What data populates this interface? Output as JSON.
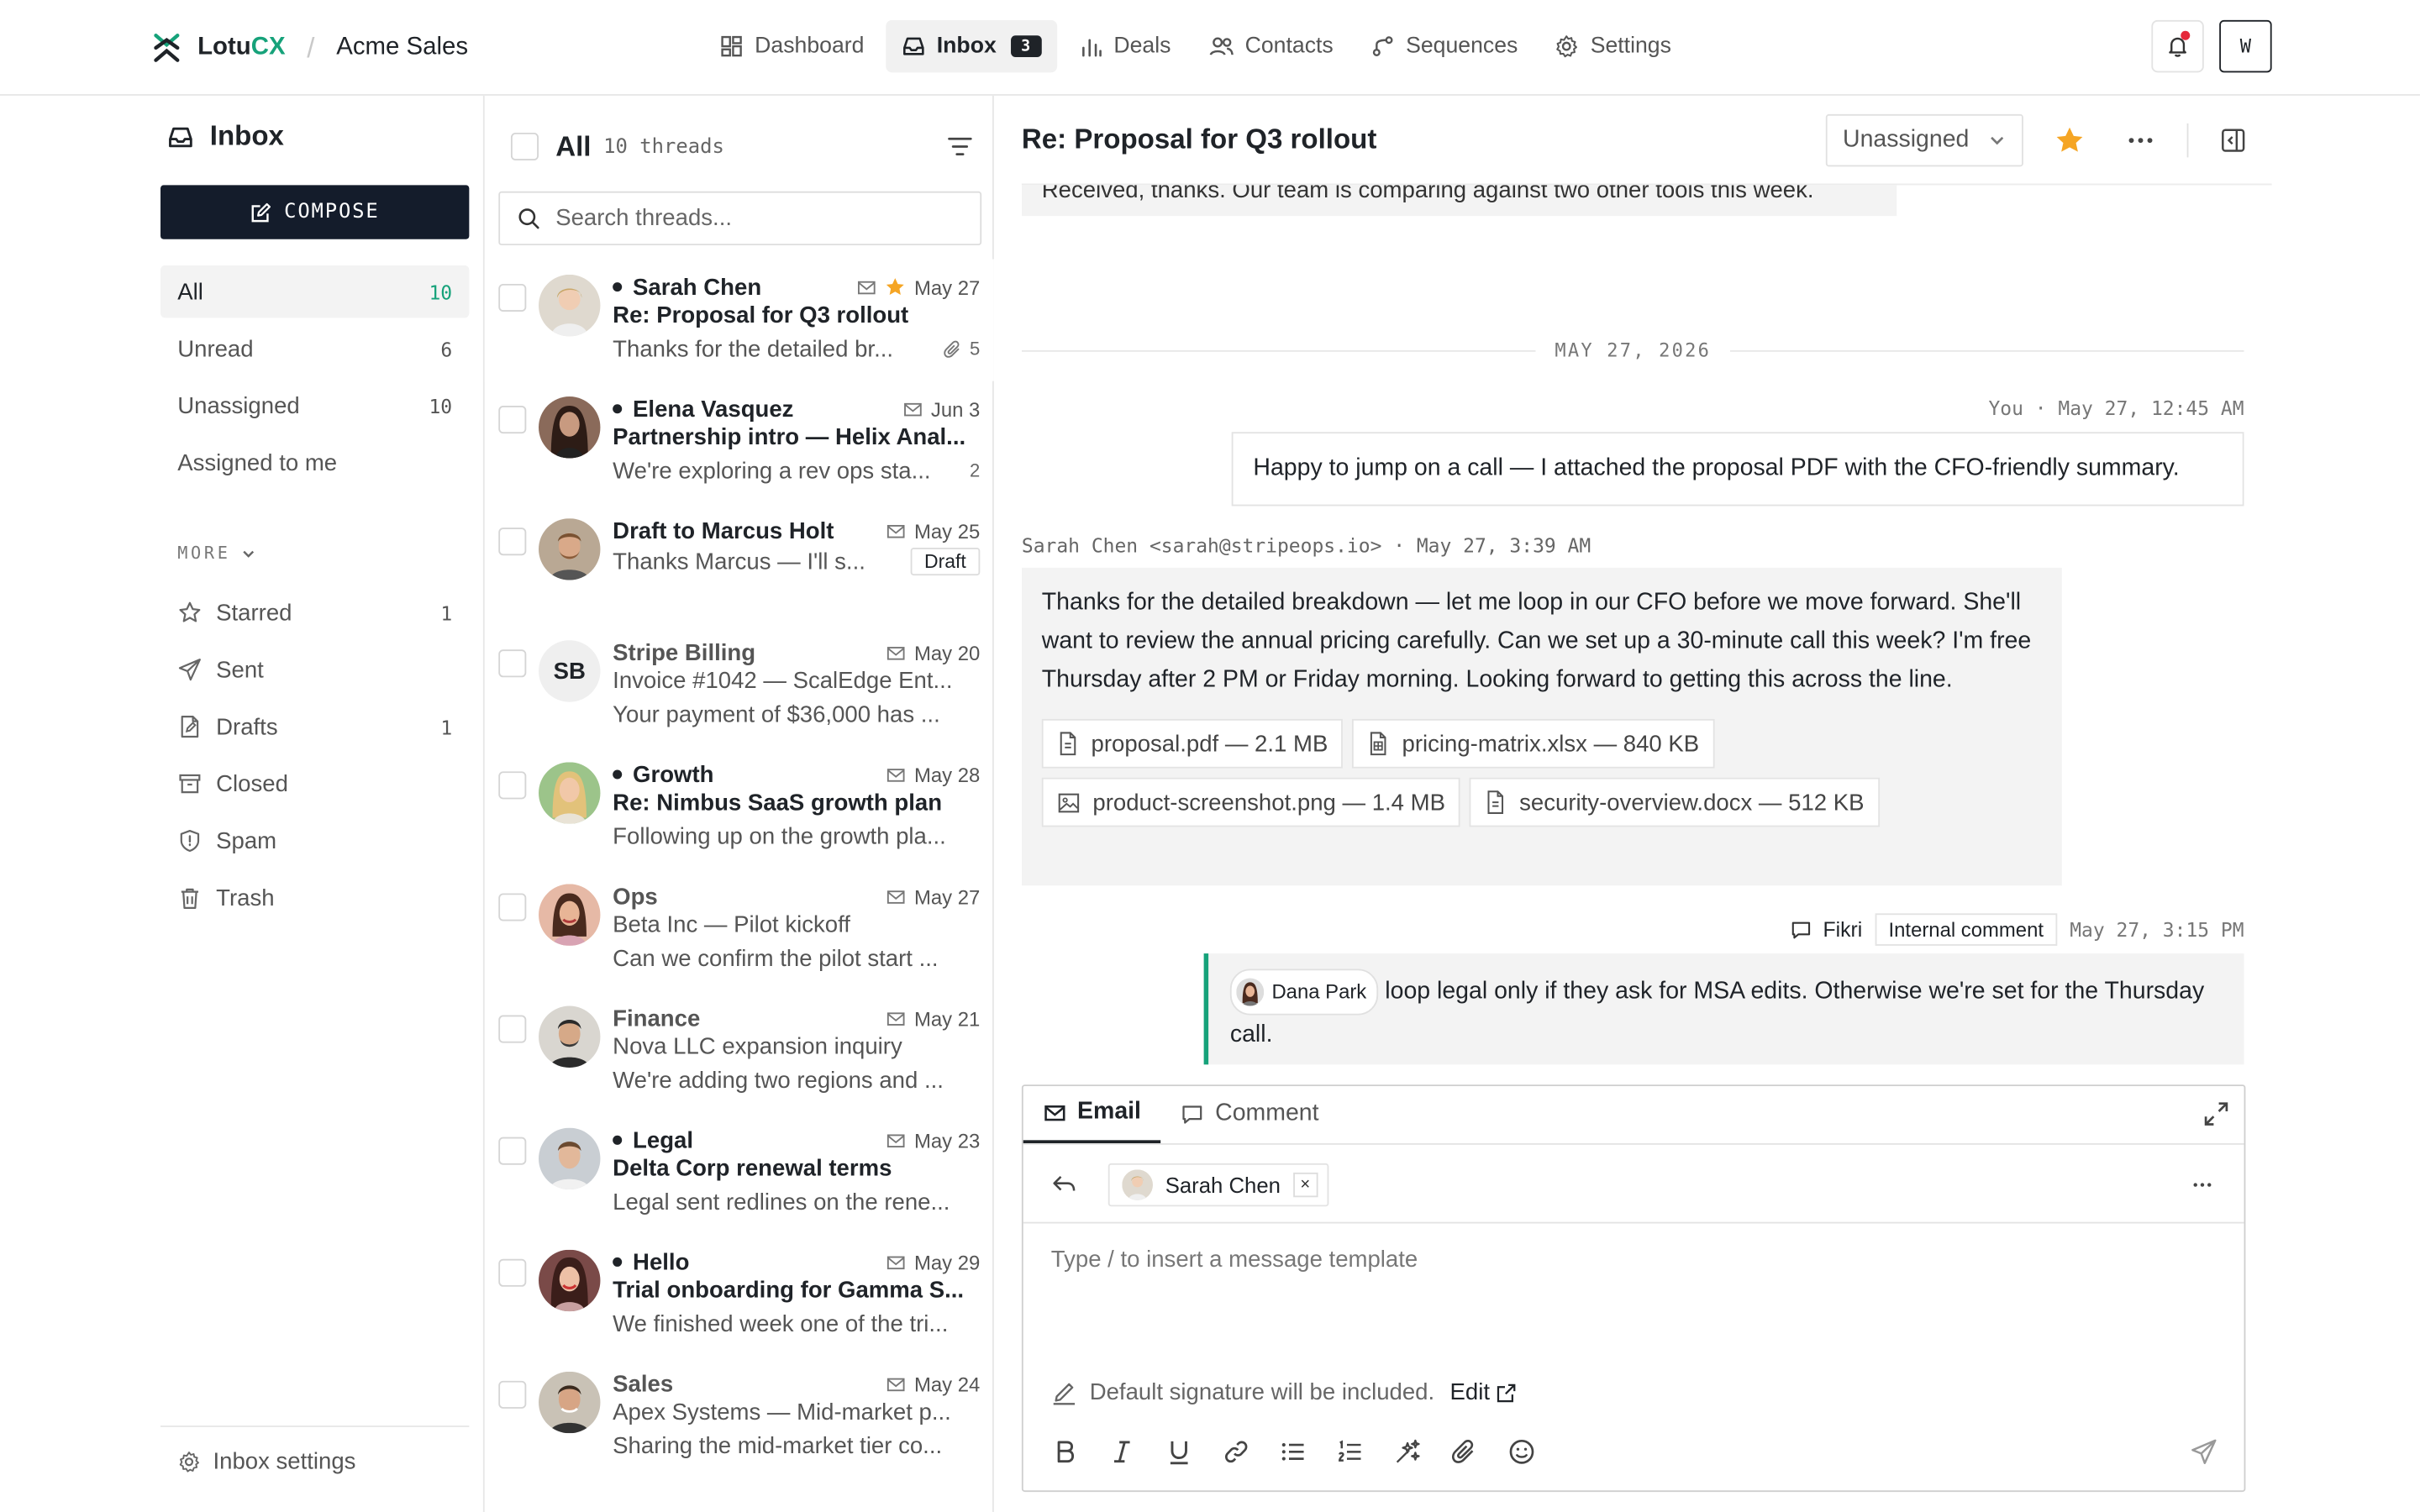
{
  "brand": {
    "name_main": "Lotu",
    "name_accent": "CX",
    "separator": "/",
    "org": "Acme Sales",
    "accent_color": "#16a27a"
  },
  "topnav": {
    "items": [
      {
        "label": "Dashboard",
        "icon": "dashboard-icon"
      },
      {
        "label": "Inbox",
        "icon": "inbox-icon",
        "badge": "3",
        "active": true
      },
      {
        "label": "Deals",
        "icon": "bar-chart-icon"
      },
      {
        "label": "Contacts",
        "icon": "users-icon"
      },
      {
        "label": "Sequences",
        "icon": "workflow-icon"
      },
      {
        "label": "Settings",
        "icon": "gear-icon"
      }
    ],
    "user_initial": "W"
  },
  "sidebar": {
    "title": "Inbox",
    "compose_label": "COMPOSE",
    "folders": [
      {
        "label": "All",
        "count": "10",
        "active": true
      },
      {
        "label": "Unread",
        "count": "6"
      },
      {
        "label": "Unassigned",
        "count": "10"
      },
      {
        "label": "Assigned to me",
        "count": ""
      }
    ],
    "more_label": "MORE",
    "more_items": [
      {
        "label": "Starred",
        "count": "1",
        "icon": "star-icon"
      },
      {
        "label": "Sent",
        "count": "",
        "icon": "send-icon"
      },
      {
        "label": "Drafts",
        "count": "1",
        "icon": "draft-icon"
      },
      {
        "label": "Closed",
        "count": "",
        "icon": "archive-icon"
      },
      {
        "label": "Spam",
        "count": "",
        "icon": "shield-icon"
      },
      {
        "label": "Trash",
        "count": "",
        "icon": "trash-icon"
      }
    ],
    "settings_label": "Inbox settings"
  },
  "threadlist": {
    "title": "All",
    "subtitle": "10 threads",
    "search_placeholder": "Search threads...",
    "threads": [
      {
        "from": "Sarah Chen",
        "unread": true,
        "date": "May 27",
        "starred": true,
        "subject": "Re: Proposal for Q3 rollout",
        "preview": "Thanks for the detailed br...",
        "attachments": "5",
        "avatar": "sarah"
      },
      {
        "from": "Elena Vasquez",
        "unread": true,
        "date": "Jun 3",
        "subject": "Partnership intro — Helix Anal...",
        "preview": "We're exploring a rev ops sta...",
        "attachments_count": "2",
        "avatar": "elena"
      },
      {
        "from": "Draft to Marcus Holt",
        "unread": true,
        "nodot": true,
        "date": "May 25",
        "subject": "",
        "preview": "Thanks Marcus — I'll s...",
        "draft_tag": "Draft",
        "avatar": "marcus"
      },
      {
        "from": "Stripe Billing",
        "unread": false,
        "date": "May 20",
        "subject": "Invoice #1042 — ScalEdge Ent...",
        "preview": "Your payment of $36,000 has ...",
        "initials": "SB"
      },
      {
        "from": "Growth",
        "unread": true,
        "date": "May 28",
        "subject": "Re: Nimbus SaaS growth plan",
        "preview": "Following up on the growth pla...",
        "avatar": "growth"
      },
      {
        "from": "Ops",
        "unread": false,
        "date": "May 27",
        "subject": "Beta Inc — Pilot kickoff",
        "preview": "Can we confirm the pilot start ...",
        "avatar": "ops"
      },
      {
        "from": "Finance",
        "unread": false,
        "date": "May 21",
        "subject": "Nova LLC expansion inquiry",
        "preview": "We're adding two regions and ...",
        "avatar": "finance"
      },
      {
        "from": "Legal",
        "unread": true,
        "date": "May 23",
        "subject": "Delta Corp renewal terms",
        "preview": "Legal sent redlines on the rene...",
        "avatar": "legal"
      },
      {
        "from": "Hello",
        "unread": true,
        "date": "May 29",
        "subject": "Trial onboarding for Gamma S...",
        "preview": "We finished week one of the tri...",
        "avatar": "hello"
      },
      {
        "from": "Sales",
        "unread": false,
        "date": "May 24",
        "subject": "Apex Systems — Mid-market p...",
        "preview": "Sharing the mid-market tier co...",
        "avatar": "sales"
      }
    ]
  },
  "conversation": {
    "title": "Re: Proposal for Q3 rollout",
    "assignee": "Unassigned",
    "clipped_message": "Received, thanks. Our team is comparing against two other tools this week.",
    "day_separator": "MAY 27, 2026",
    "outgoing": {
      "meta": "You · May 27, 12:45 AM",
      "body": "Happy to jump on a call — I attached the proposal PDF with the CFO-friendly summary."
    },
    "incoming": {
      "meta": "Sarah Chen <sarah@stripeops.io> · May 27, 3:39 AM",
      "body": "Thanks for the detailed breakdown — let me loop in our CFO before we move forward. She'll want to review the annual pricing carefully. Can we set up a 30-minute call this week? I'm free Thursday after 2 PM or Friday morning. Looking forward to getting this across the line.",
      "attachments": [
        {
          "label": "proposal.pdf — 2.1 MB",
          "icon": "file-icon"
        },
        {
          "label": "pricing-matrix.xlsx — 840 KB",
          "icon": "spreadsheet-icon"
        },
        {
          "label": "product-screenshot.png — 1.4 MB",
          "icon": "image-icon"
        },
        {
          "label": "security-overview.docx — 512 KB",
          "icon": "doc-icon"
        }
      ]
    },
    "comment": {
      "author": "Fikri",
      "tag": "Internal comment",
      "time": "May 27, 3:15 PM",
      "mention": "Dana Park",
      "body": "loop legal only if they ask for MSA edits. Otherwise we're set for the Thursday call."
    }
  },
  "composer": {
    "tab_email": "Email",
    "tab_comment": "Comment",
    "recipient": "Sarah Chen",
    "recipient_remove": "×",
    "placeholder": "Type / to insert a message template",
    "signature_note": "Default signature will be included.",
    "signature_edit": "Edit"
  }
}
